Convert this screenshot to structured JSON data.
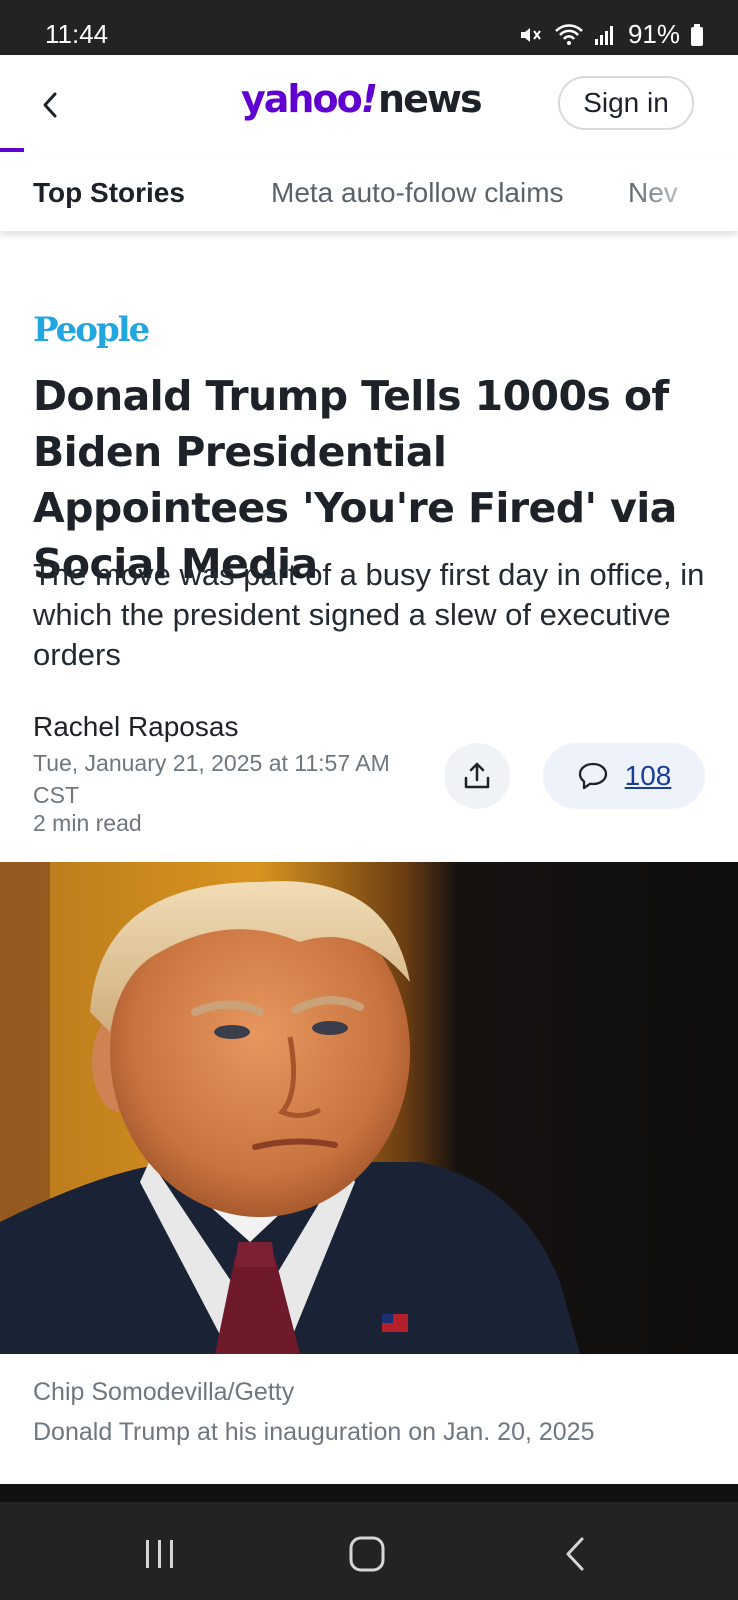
{
  "status_bar": {
    "time": "11:44",
    "battery": "91%",
    "icons": [
      "mute-icon",
      "wifi-icon",
      "signal-icon",
      "battery-icon"
    ]
  },
  "header": {
    "logo_yahoo": "yahoo",
    "logo_bang": "!",
    "logo_news": "news",
    "sign_in_label": "Sign in",
    "accent_color": "#6001d2"
  },
  "tabs": [
    {
      "label": "Top Stories",
      "active": true
    },
    {
      "label": "Meta auto-follow claims",
      "active": false
    },
    {
      "label": "Nev",
      "active": false
    }
  ],
  "article": {
    "source": "People",
    "headline": "Donald Trump Tells 1000s of Biden Presidential Appointees 'You're Fired' via Social Media",
    "subheadline": "The move was part of a busy first day in office, in which the president signed a slew of executive orders",
    "author": "Rachel Raposas",
    "date": "Tue, January 21, 2025 at 11:57 AM CST",
    "read_time": "2 min read",
    "comment_count": "108"
  },
  "photo": {
    "credit": "Chip Somodevilla/Getty",
    "caption": "Donald Trump at his inauguration on Jan. 20, 2025"
  },
  "nav_bar": {
    "icons": [
      "recent-apps-icon",
      "home-icon",
      "back-nav-icon"
    ]
  }
}
